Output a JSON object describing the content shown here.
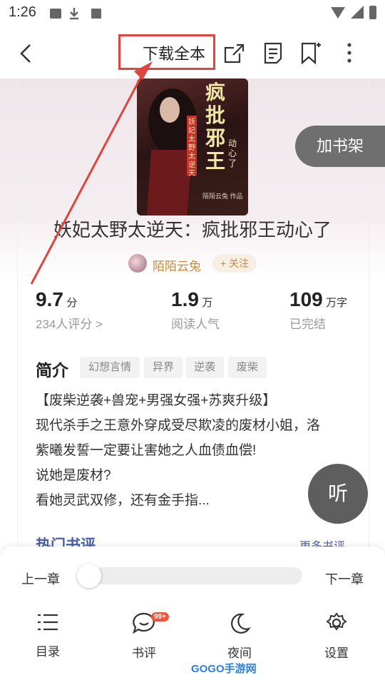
{
  "status_bar": {
    "time": "1:26"
  },
  "toolbar": {
    "download_all_label": "下载全本"
  },
  "book": {
    "cover_title_main": "疯批邪王",
    "cover_title_sub": "动心了",
    "cover_series": "妖妃太野太逆天",
    "cover_author": "陌陌云兔 作品",
    "title": "妖妃太野太逆天：疯批邪王动心了",
    "author": "陌陌云兔",
    "follow_label": "+ 关注",
    "add_shelf_label": "加书架"
  },
  "stats": [
    {
      "value": "9.7",
      "unit": "分",
      "sub": "234人评分 >"
    },
    {
      "value": "1.9",
      "unit": "万",
      "sub": "阅读人气"
    },
    {
      "value": "109",
      "unit": "万字",
      "sub": "已完结"
    }
  ],
  "intro": {
    "heading": "简介",
    "tags": [
      "幻想言情",
      "异界",
      "逆袭",
      "废柴"
    ],
    "lines": [
      "【废柴逆袭+兽宠+男强女强+苏爽升级】",
      "现代杀手之王意外穿成受尽欺凌的废材小姐，洛",
      "紫曦发誓一定要让害她之人血债血偿!",
      "说她是废材?",
      "看她灵武双修，还有金手指..."
    ]
  },
  "listen_label": "听",
  "reviews": {
    "heading": "热门书评",
    "more_label": "更多书评"
  },
  "reader_panel": {
    "prev_label": "上一章",
    "next_label": "下一章",
    "progress": 0,
    "nav": [
      {
        "label": "目录",
        "icon": "list-icon"
      },
      {
        "label": "书评",
        "icon": "comment-icon",
        "badge": "99+"
      },
      {
        "label": "夜间",
        "icon": "moon-icon"
      },
      {
        "label": "设置",
        "icon": "gear-icon"
      }
    ]
  },
  "watermark": "GOGO手游网",
  "colors": {
    "accent": "#c98a3b",
    "annotation": "#e0443f",
    "link": "#4a5fa8"
  }
}
